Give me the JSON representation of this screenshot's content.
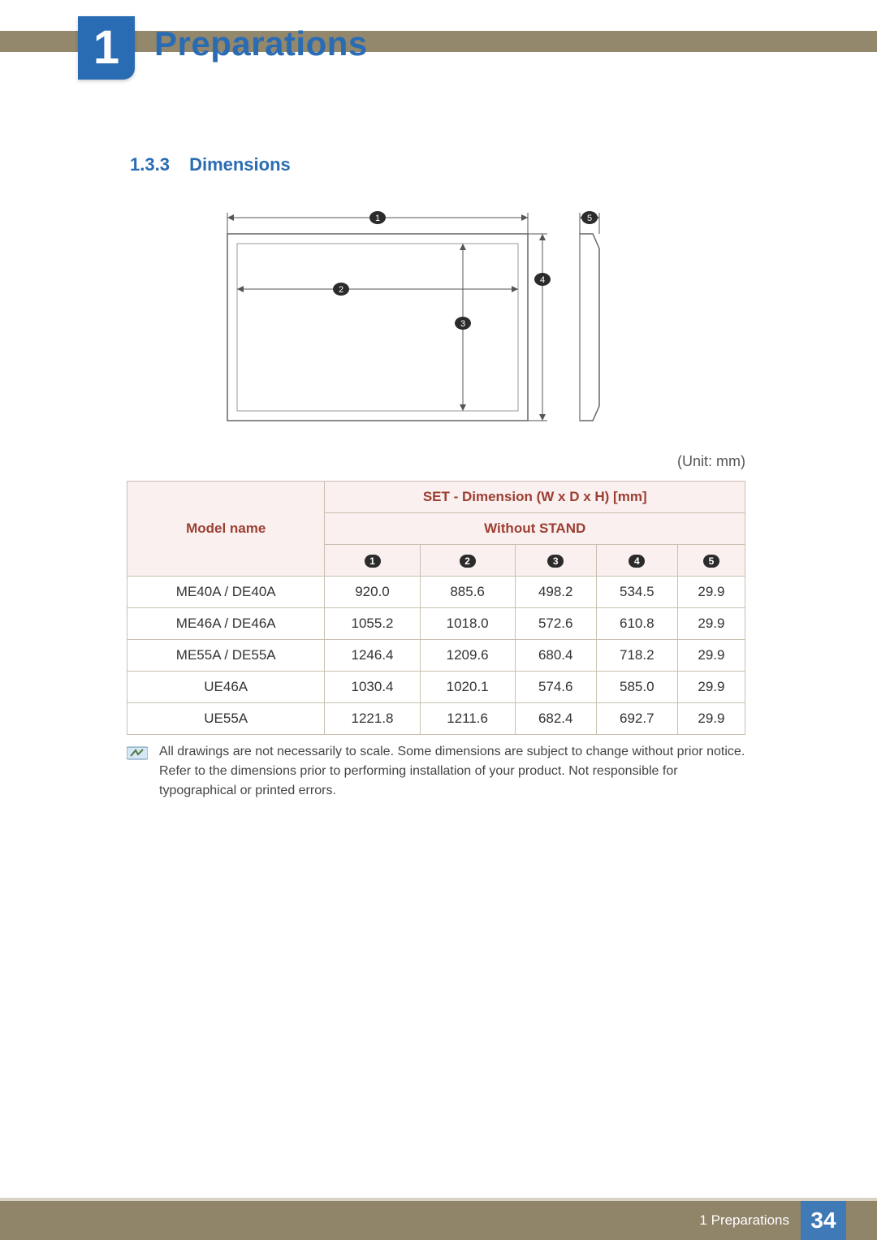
{
  "chapter": {
    "number": "1",
    "title": "Preparations"
  },
  "section": {
    "number": "1.3.3",
    "title": "Dimensions"
  },
  "unit_note": "(Unit: mm)",
  "diagram_labels": {
    "1": "1",
    "2": "2",
    "3": "3",
    "4": "4",
    "5": "5"
  },
  "table": {
    "model_header": "Model name",
    "set_header": "SET - Dimension (W x D x H) [mm]",
    "without_stand": "Without STAND",
    "col_labels": [
      "1",
      "2",
      "3",
      "4",
      "5"
    ],
    "rows": [
      {
        "model": "ME40A / DE40A",
        "v": [
          "920.0",
          "885.6",
          "498.2",
          "534.5",
          "29.9"
        ]
      },
      {
        "model": "ME46A / DE46A",
        "v": [
          "1055.2",
          "1018.0",
          "572.6",
          "610.8",
          "29.9"
        ]
      },
      {
        "model": "ME55A / DE55A",
        "v": [
          "1246.4",
          "1209.6",
          "680.4",
          "718.2",
          "29.9"
        ]
      },
      {
        "model": "UE46A",
        "v": [
          "1030.4",
          "1020.1",
          "574.6",
          "585.0",
          "29.9"
        ]
      },
      {
        "model": "UE55A",
        "v": [
          "1221.8",
          "1211.6",
          "682.4",
          "692.7",
          "29.9"
        ]
      }
    ]
  },
  "note_text": "All drawings are not necessarily to scale. Some dimensions are subject to change without prior notice. Refer to the dimensions prior to performing installation of your product. Not responsible for typographical or printed errors.",
  "footer": {
    "breadcrumb": "1 Preparations",
    "page": "34"
  },
  "chart_data": {
    "type": "table",
    "title": "SET - Dimension (W x D x H) [mm] — Without STAND",
    "columns": [
      "Model name",
      "1",
      "2",
      "3",
      "4",
      "5"
    ],
    "rows": [
      [
        "ME40A / DE40A",
        920.0,
        885.6,
        498.2,
        534.5,
        29.9
      ],
      [
        "ME46A / DE46A",
        1055.2,
        1018.0,
        572.6,
        610.8,
        29.9
      ],
      [
        "ME55A / DE55A",
        1246.4,
        1209.6,
        680.4,
        718.2,
        29.9
      ],
      [
        "UE46A",
        1030.4,
        1020.1,
        574.6,
        585.0,
        29.9
      ],
      [
        "UE55A",
        1221.8,
        1211.6,
        682.4,
        692.7,
        29.9
      ]
    ],
    "unit": "mm"
  }
}
